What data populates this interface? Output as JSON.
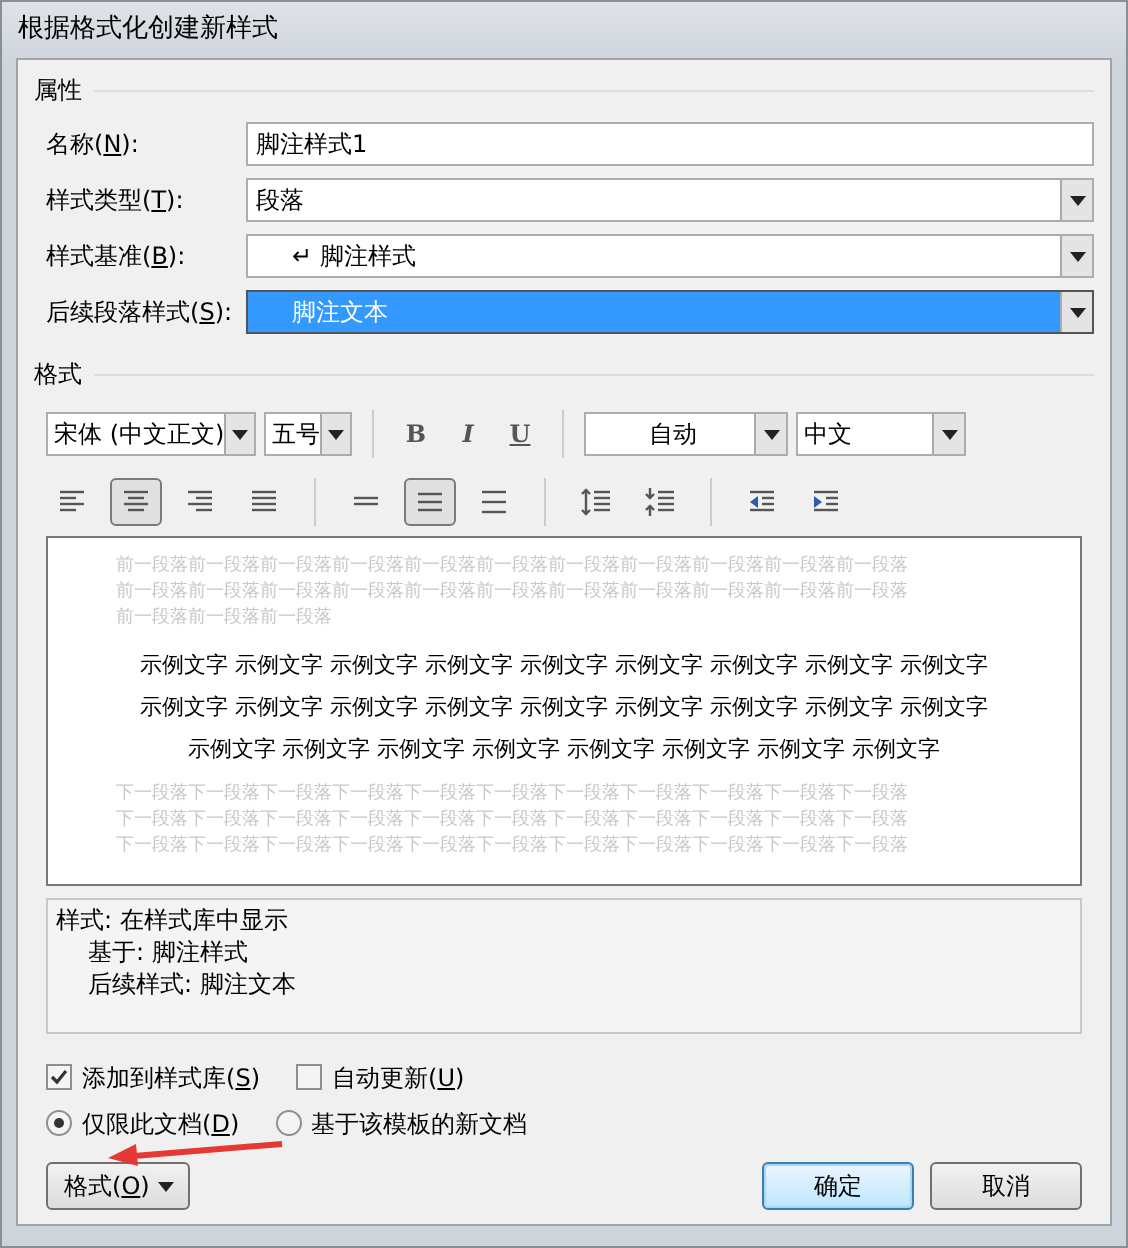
{
  "window": {
    "title": "根据格式化创建新样式"
  },
  "properties": {
    "title": "属性",
    "rows": [
      {
        "kind": "text",
        "label": "名称(",
        "mnemonic": "N",
        "label_end": "):",
        "value": "脚注样式1"
      },
      {
        "kind": "select",
        "label": "样式类型(",
        "mnemonic": "T",
        "label_end": "):",
        "value": "段落"
      },
      {
        "kind": "select",
        "label": "样式基准(",
        "mnemonic": "B",
        "label_end": "):",
        "prefix": "↵",
        "value": "脚注样式"
      },
      {
        "kind": "select",
        "label": "后续段落样式(",
        "mnemonic": "S",
        "label_end": "):",
        "value": "脚注文本",
        "highlighted": true
      }
    ]
  },
  "format": {
    "title": "格式",
    "font": "宋体 (中文正文)",
    "size": "五号",
    "style_buttons": [
      {
        "kind": "bold",
        "label": "B"
      },
      {
        "kind": "italic",
        "label": "I"
      },
      {
        "kind": "underline",
        "label": "U"
      }
    ],
    "color_select": "自动",
    "language": "中文",
    "align_buttons": [
      {
        "kind": "left",
        "selected": false
      },
      {
        "kind": "center",
        "selected": true
      },
      {
        "kind": "right",
        "selected": false
      },
      {
        "kind": "justify",
        "selected": false
      }
    ],
    "spacing_buttons": [
      {
        "kind": "single",
        "selected": false
      },
      {
        "kind": "one_half",
        "selected": true
      },
      {
        "kind": "double",
        "selected": false
      }
    ],
    "paragraph_buttons": [
      {
        "kind": "increase_spacing"
      },
      {
        "kind": "decrease_spacing"
      }
    ],
    "indent_buttons": [
      {
        "kind": "decrease_indent"
      },
      {
        "kind": "increase_indent"
      }
    ]
  },
  "preview": {
    "previous_lines": [
      "前一段落前一段落前一段落前一段落前一段落前一段落前一段落前一段落前一段落前一段落前一段落",
      "前一段落前一段落前一段落前一段落前一段落前一段落前一段落前一段落前一段落前一段落前一段落",
      "前一段落前一段落前一段落"
    ],
    "sample_lines": [
      "示例文字 示例文字 示例文字 示例文字 示例文字 示例文字 示例文字 示例文字 示例文字",
      "示例文字 示例文字 示例文字 示例文字 示例文字 示例文字 示例文字 示例文字 示例文字",
      "示例文字 示例文字 示例文字 示例文字 示例文字 示例文字 示例文字 示例文字"
    ],
    "next_lines": [
      "下一段落下一段落下一段落下一段落下一段落下一段落下一段落下一段落下一段落下一段落下一段落",
      "下一段落下一段落下一段落下一段落下一段落下一段落下一段落下一段落下一段落下一段落下一段落",
      "下一段落下一段落下一段落下一段落下一段落下一段落下一段落下一段落下一段落下一段落下一段落"
    ]
  },
  "description": [
    {
      "text": "样式: 在样式库中显示",
      "indented": false
    },
    {
      "text": "基于: 脚注样式",
      "indented": true
    },
    {
      "text": "后续样式: 脚注文本",
      "indented": true
    }
  ],
  "options": {
    "checkboxes": [
      {
        "label": "添加到样式库(",
        "mnemonic": "S",
        "label_end": ")",
        "checked": true
      },
      {
        "label": "自动更新(",
        "mnemonic": "U",
        "label_end": ")",
        "checked": false
      }
    ],
    "radios": [
      {
        "label": "仅限此文档(",
        "mnemonic": "D",
        "label_end": ")",
        "selected": true
      },
      {
        "label": "基于该模板的新文档",
        "selected": false
      }
    ]
  },
  "buttons": [
    {
      "kind": "menu",
      "label": "格式(",
      "mnemonic": "O",
      "label_end": ")"
    },
    {
      "kind": "default",
      "label": "确定"
    },
    {
      "kind": "normal",
      "label": "取消"
    }
  ]
}
